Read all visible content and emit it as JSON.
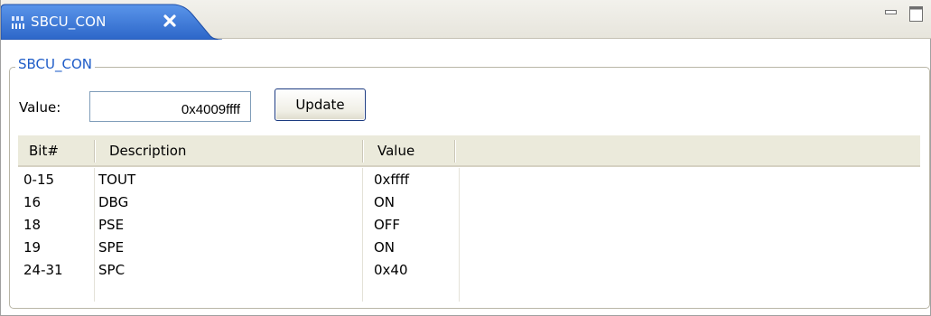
{
  "tab": {
    "title": "SBCU_CON",
    "icon": "register-icon",
    "close_icon": "close-icon"
  },
  "view_controls": {
    "minimize_icon": "minimize-icon",
    "maximize_icon": "maximize-icon"
  },
  "group": {
    "legend": "SBCU_CON"
  },
  "value_field": {
    "label": "Value:",
    "value": "0x4009ffff"
  },
  "update_button": {
    "label": "Update"
  },
  "table": {
    "headers": [
      "Bit#",
      "Description",
      "Value"
    ],
    "rows": [
      [
        "0-15",
        "TOUT",
        "0xffff"
      ],
      [
        "16",
        "DBG",
        "ON"
      ],
      [
        "18",
        "PSE",
        "OFF"
      ],
      [
        "19",
        "SPE",
        "ON"
      ],
      [
        "24-31",
        "SPC",
        "0x40"
      ]
    ]
  },
  "colors": {
    "tab_active": "#3a78d8",
    "legend_text": "#1e5cc8",
    "header_bg": "#ebeadb"
  }
}
